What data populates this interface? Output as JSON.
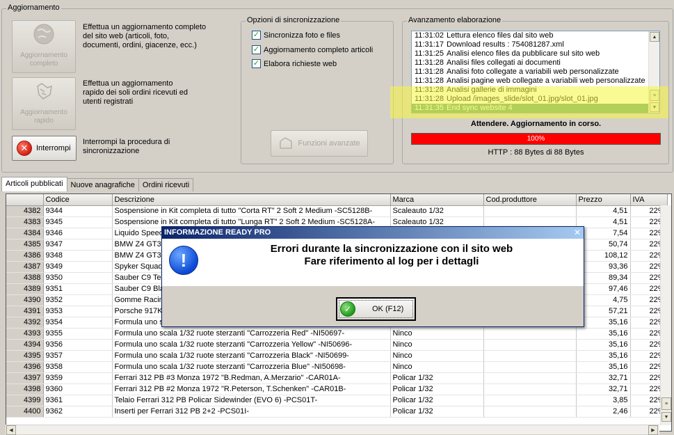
{
  "groups": {
    "aggiornamento": "Aggiornamento",
    "opzioni": "Opzioni di sincronizzazione",
    "avanzamento": "Avanzamento elaborazione"
  },
  "left": {
    "btn_completo": "Aggiornamento completo",
    "desc_completo": [
      "Effettua un aggiornamento completo",
      "del sito web (articoli, foto,",
      "documenti, ordini, giacenze, ecc.)"
    ],
    "btn_rapido": "Aggiornamento rapido",
    "desc_rapido": [
      "Effettua un aggiornamento",
      "rapido dei soli ordini ricevuti ed",
      "utenti registrati"
    ],
    "btn_interrompi": "Interrompi",
    "desc_interrompi": [
      "Interrompi la procedura di",
      "sincronizzazione"
    ]
  },
  "options": [
    {
      "label": "Sincronizza foto e files",
      "checked": true
    },
    {
      "label": "Aggiornamento completo articoli",
      "checked": true
    },
    {
      "label": "Elabora richieste web",
      "checked": true
    }
  ],
  "btn_funzioni": "Funzioni avanzate",
  "log": [
    {
      "time": "11:31:02",
      "text": "Lettura elenco files dal sito web"
    },
    {
      "time": "11:31:17",
      "text": "Download results : 754081287.xml"
    },
    {
      "time": "11:31:25",
      "text": "Analisi elenco files da pubblicare sul sito web"
    },
    {
      "time": "11:31:28",
      "text": "Analisi files collegati ai documenti"
    },
    {
      "time": "11:31:28",
      "text": "Analisi foto collegate a variabili web personalizzate"
    },
    {
      "time": "11:31:28",
      "text": "Analisi pagine web collegate a variabili web personalizzate"
    },
    {
      "time": "11:31:28",
      "text": "Analisi gallerie di immagini"
    },
    {
      "time": "11:31:28",
      "text": "Upload /images_slide/slot_01.jpg/slot_01.jpg"
    },
    {
      "time": "11:31:35",
      "text": "End sync website 4"
    }
  ],
  "status": "Attendere. Aggiornamento in corso.",
  "progress": {
    "label": "100%",
    "value": 100
  },
  "http": "HTTP : 88 Bytes di 88 Bytes",
  "tabs": [
    "Articoli pubblicati",
    "Nuove anagrafiche",
    "Ordini ricevuti"
  ],
  "grid": {
    "columns": [
      "",
      "Codice",
      "Descrizione",
      "Marca",
      "Cod.produttore",
      "Prezzo",
      "IVA"
    ],
    "rows": [
      [
        "4382",
        "9344",
        "Sospensione in Kit completa di tutto \"Corta RT\" 2 Soft 2 Medium -SC5128B-",
        "Scaleauto 1/32",
        "",
        "4,51",
        "22%"
      ],
      [
        "4383",
        "9345",
        "Sospensione in Kit completa di tutto \"Lunga RT\" 2 Soft 2 Medium -SC5128A-",
        "Scaleauto 1/32",
        "",
        "4,51",
        "22%"
      ],
      [
        "4384",
        "9346",
        "Liquido Speed",
        "",
        "",
        "7,54",
        "22%"
      ],
      [
        "4385",
        "9347",
        "BMW Z4 GT3",
        "",
        "",
        "50,74",
        "22%"
      ],
      [
        "4386",
        "9348",
        "BMW Z4 GT3",
        "",
        "",
        "108,12",
        "22%"
      ],
      [
        "4387",
        "9349",
        "Spyker Squad",
        "",
        "",
        "93,36",
        "22%"
      ],
      [
        "4388",
        "9350",
        "Sauber C9 Tea",
        "",
        "",
        "89,34",
        "22%"
      ],
      [
        "4389",
        "9351",
        "Sauber C9 Bla",
        "",
        "",
        "97,46",
        "22%"
      ],
      [
        "4390",
        "9352",
        "Gomme Racing",
        "",
        "",
        "4,75",
        "22%"
      ],
      [
        "4391",
        "9353",
        "Porsche 917K",
        "",
        "",
        "57,21",
        "22%"
      ],
      [
        "4392",
        "9354",
        "Formula uno s",
        "",
        "",
        "35,16",
        "22%"
      ],
      [
        "4393",
        "9355",
        "Formula uno scala 1/32 ruote sterzanti \"Carrozzeria Red\" -NI50697-",
        "Ninco",
        "",
        "35,16",
        "22%"
      ],
      [
        "4394",
        "9356",
        "Formula uno scala 1/32 ruote sterzanti \"Carrozzeria Yellow\" -NI50696-",
        "Ninco",
        "",
        "35,16",
        "22%"
      ],
      [
        "4395",
        "9357",
        "Formula uno scala 1/32 ruote sterzanti \"Carrozzeria Black\" -NI50699-",
        "Ninco",
        "",
        "35,16",
        "22%"
      ],
      [
        "4396",
        "9358",
        "Formula uno scala 1/32 ruote sterzanti \"Carrozzeria Blue\" -NI50698-",
        "Ninco",
        "",
        "35,16",
        "22%"
      ],
      [
        "4397",
        "9359",
        "Ferrari 312 PB #3 Monza 1972 \"B.Redman, A.Merzario\" -CAR01A-",
        "Policar 1/32",
        "",
        "32,71",
        "22%"
      ],
      [
        "4398",
        "9360",
        "Ferrari 312 PB #2 Monza 1972 \"R.Peterson, T.Schenken\" -CAR01B-",
        "Policar 1/32",
        "",
        "32,71",
        "22%"
      ],
      [
        "4399",
        "9361",
        "Telaio Ferrari 312 PB Policar Sidewinder (EVO 6) -PCS01T-",
        "Policar 1/32",
        "",
        "3,85",
        "22%"
      ],
      [
        "4400",
        "9362",
        "Inserti per Ferrari 312 PB 2+2 -PCS01I-",
        "Policar 1/32",
        "",
        "2,46",
        "22%"
      ]
    ]
  },
  "dialog": {
    "title": "INFORMAZIONE READY PRO",
    "line1": "Errori durante la sincronizzazione con il sito web",
    "line2": "Fare riferimento al log per i dettagli",
    "ok": "OK (F12)"
  },
  "colors": {
    "progress": "#ff0000",
    "log_selected": "#5f9f7a",
    "highlight": "#f5f53c",
    "dialog_title": "#0a246a"
  }
}
